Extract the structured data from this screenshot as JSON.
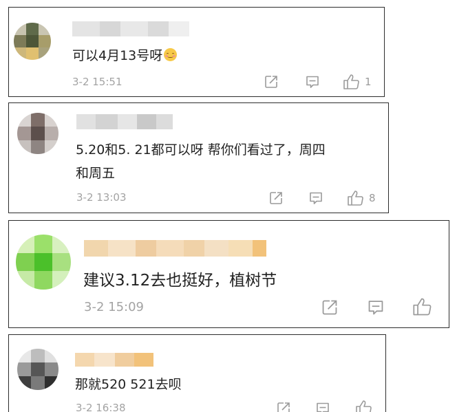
{
  "comments": [
    {
      "text": "可以4月13号呀",
      "emoji": "smiling-face-emoji",
      "time": "3-2 15:51",
      "like_count": "1",
      "avatar_color": "#8a8a6a"
    },
    {
      "text_line1": "5.20和5. 21都可以呀 帮你们看过了，周四",
      "text_line2": "和周五",
      "time": "3-2 13:03",
      "like_count": "8",
      "avatar_color": "#9a8c88"
    },
    {
      "text": "建议3.12去也挺好，植树节",
      "time": "3-2 15:09",
      "avatar_color": "#6cc83c",
      "name_color": "#f0c98f"
    },
    {
      "text": "那就520 521去呗",
      "time": "3-2 16:38",
      "avatar_color": "#6a6a6a",
      "name_color": "#f2c27a"
    }
  ],
  "icons": {
    "share": "share-icon",
    "comment": "comment-icon",
    "like": "thumbs-up-icon"
  }
}
